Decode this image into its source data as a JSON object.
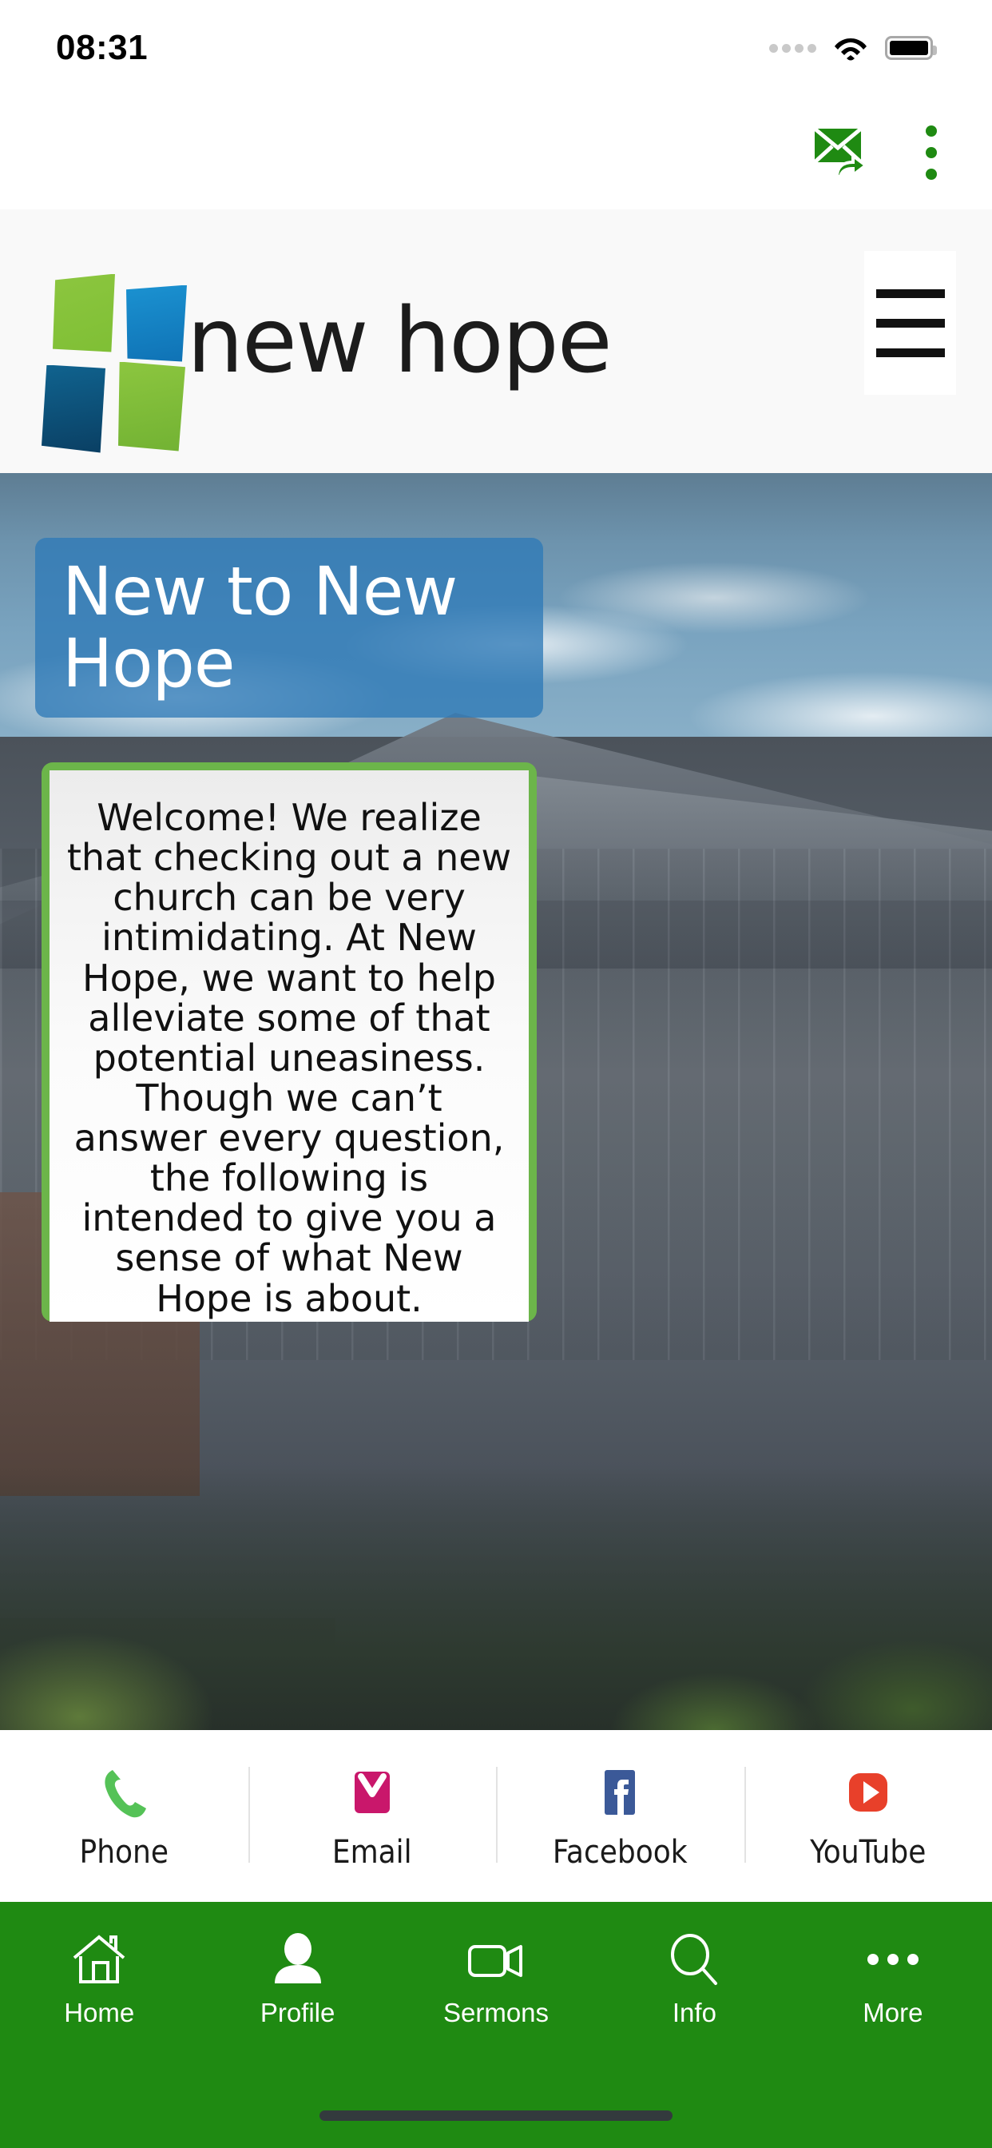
{
  "status_bar": {
    "time": "08:31",
    "signal_icon": "signal-dots-icon",
    "wifi_icon": "wifi-icon",
    "battery_icon": "battery-full-icon"
  },
  "app_actions": {
    "share_label": "share-email-icon",
    "overflow_label": "overflow-menu-icon",
    "accent_color": "#1f8a12"
  },
  "brand_header": {
    "logo_text": "new hope",
    "logo_icon": "new-hope-cross-logo",
    "menu_icon": "hamburger-menu-icon",
    "background_color": "#f9f9f9",
    "logo_colors": {
      "top_left": "#8cc63f",
      "top_right": "#1b92d1",
      "bottom_left": "#0a3f63",
      "bottom_right": "#72b233"
    }
  },
  "hero": {
    "title": "New to New Hope",
    "title_card_color": "#2e7ab7",
    "body_card_border_color": "#6cb54a",
    "body_text": "Welcome! We realize that checking out a new church can be very intimidating. At New Hope, we want to help alleviate some of that potential uneasiness. Though we can’t answer every question, the following is intended to give you a sense of what New Hope is about."
  },
  "social_bar": {
    "items": [
      {
        "label": "Phone",
        "icon": "phone-icon",
        "color": "#55c257"
      },
      {
        "label": "Email",
        "icon": "envelope-icon",
        "color": "#c9176b"
      },
      {
        "label": "Facebook",
        "icon": "facebook-icon",
        "color": "#3b5998"
      },
      {
        "label": "YouTube",
        "icon": "youtube-icon",
        "color": "#e8402a"
      }
    ]
  },
  "tab_bar": {
    "background_color": "#1f8a12",
    "items": [
      {
        "label": "Home",
        "icon": "home-icon"
      },
      {
        "label": "Profile",
        "icon": "person-icon"
      },
      {
        "label": "Sermons",
        "icon": "video-camera-icon"
      },
      {
        "label": "Info",
        "icon": "search-icon"
      },
      {
        "label": "More",
        "icon": "ellipsis-icon"
      }
    ]
  }
}
